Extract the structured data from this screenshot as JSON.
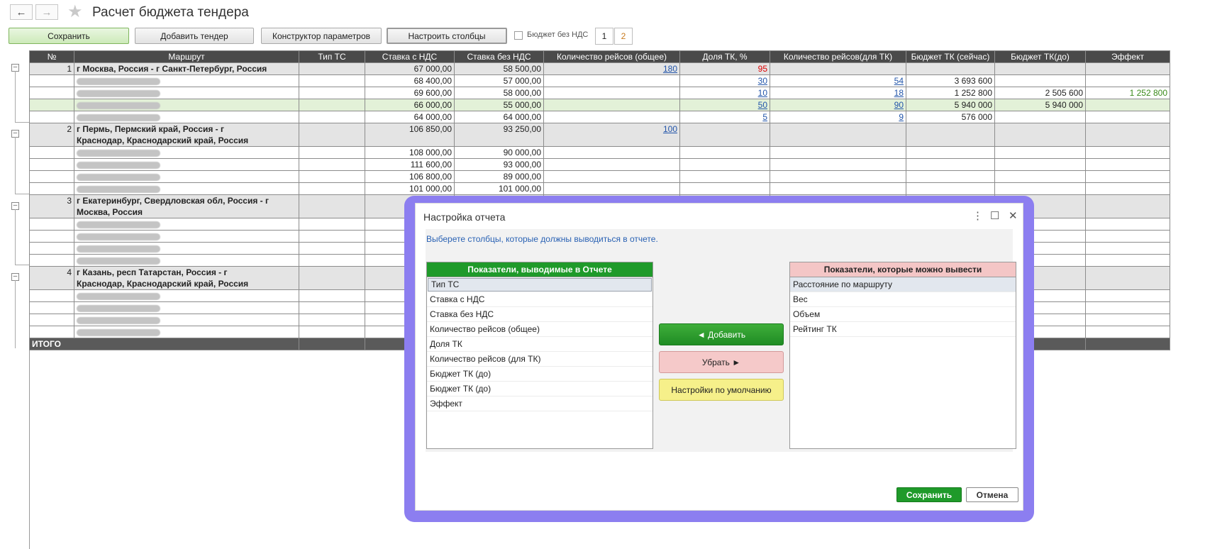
{
  "header": {
    "title": "Расчет бюджета тендера",
    "back_icon": "←",
    "forward_icon": "→",
    "star_icon": "★"
  },
  "toolbar": {
    "save": "Сохранить",
    "add_tender": "Добавить тендер",
    "param_builder": "Конструктор параметров",
    "setup_columns": "Настроить столбцы",
    "budget_no_vat": "Бюджет без НДС",
    "pages": [
      "1",
      "2"
    ]
  },
  "table": {
    "columns": [
      "№",
      "Маршрут",
      "Тип ТС",
      "Ставка с НДС",
      "Ставка без НДС",
      "Количество рейсов (общее)",
      "Доля ТК, %",
      "Количество рейсов(для ТК)",
      "Бюджет ТК (сейчас)",
      "Бюджет ТК(до)",
      "Эффект"
    ],
    "r1": {
      "num": "1",
      "route": "г Москва, Россия - г Санкт-Петербург, Россия",
      "rate_vat": "67 000,00",
      "rate_novat": "58 500,00",
      "trips": "180",
      "share": "95"
    },
    "r1c1": {
      "rate_vat": "68 400,00",
      "rate_novat": "57 000,00",
      "share": "30",
      "trips_tk": "54",
      "budget_now": "3 693 600"
    },
    "r1c2": {
      "rate_vat": "69 600,00",
      "rate_novat": "58 000,00",
      "share": "10",
      "trips_tk": "18",
      "budget_now": "1 252 800",
      "budget_before": "2 505 600",
      "effect": "1 252 800"
    },
    "r1c3": {
      "rate_vat": "66 000,00",
      "rate_novat": "55 000,00",
      "share": "50",
      "trips_tk": "90",
      "budget_now": "5 940 000",
      "budget_before": "5 940 000"
    },
    "r1c4": {
      "rate_vat": "64 000,00",
      "rate_novat": "64 000,00",
      "share": "5",
      "trips_tk": "9",
      "budget_now": "576 000"
    },
    "r2": {
      "num": "2",
      "route1": "г Пермь, Пермский край, Россия - г",
      "route2": "Краснодар, Краснодарский край, Россия",
      "rate_vat": "106 850,00",
      "rate_novat": "93 250,00",
      "trips": "100"
    },
    "r2c1": {
      "rate_vat": "108 000,00",
      "rate_novat": "90 000,00"
    },
    "r2c2": {
      "rate_vat": "111 600,00",
      "rate_novat": "93 000,00"
    },
    "r2c3": {
      "rate_vat": "106 800,00",
      "rate_novat": "89 000,00"
    },
    "r2c4": {
      "rate_vat": "101 000,00",
      "rate_novat": "101 000,00"
    },
    "r3": {
      "num": "3",
      "route1": "г Екатеринбург, Свердловская обл, Россия - г",
      "route2": "Москва, Россия"
    },
    "r4": {
      "num": "4",
      "route1": "г Казань, респ Татарстан, Россия - г",
      "route2": "Краснодар, Краснодарский край, Россия"
    },
    "total": "ИТОГО"
  },
  "dialog": {
    "title": "Настройка отчета",
    "menu_icon": "⋮",
    "maximize_icon": "☐",
    "close_icon": "✕",
    "hint": "Выберете столбцы, которые должны выводиться в отчете.",
    "left_header": "Показатели, выводимые в Отчете",
    "left_items": [
      "Тип ТС",
      "Ставка с НДС",
      "Ставка без НДС",
      "Количество рейсов (общее)",
      "Доля ТК",
      "Количество рейсов (для ТК)",
      "Бюджет ТК (до)",
      "Бюджет ТК (до)",
      "Эффект"
    ],
    "right_header": "Показатели, которые можно вывести",
    "right_items": [
      "Расстояние по маршруту",
      "Вес",
      "Объем",
      "Рейтинг ТК"
    ],
    "add": "◄ Добавить",
    "remove": "Убрать ►",
    "defaults": "Настройки по умолчанию",
    "save": "Сохранить",
    "cancel": "Отмена"
  },
  "colors": {
    "green_header": "#1f9a2a",
    "pink_header": "#f4c6c6",
    "frame": "#8c7ef0",
    "link": "#2255aa"
  }
}
